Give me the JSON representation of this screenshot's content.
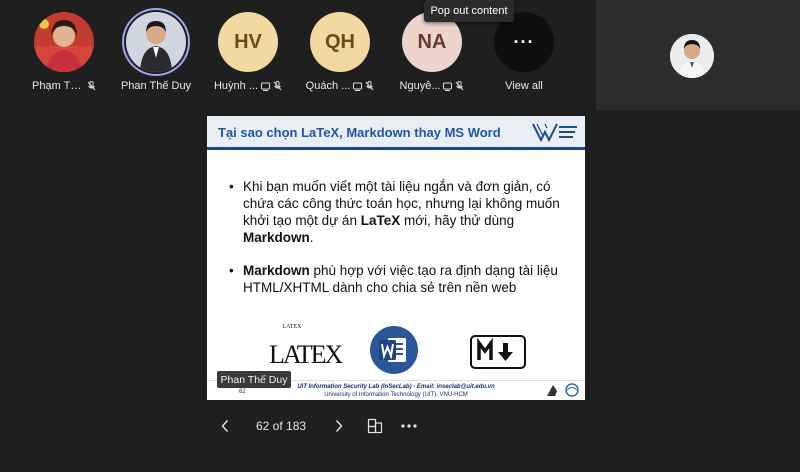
{
  "participants": [
    {
      "name": "Phạm Thị ...",
      "type": "photo",
      "muted": true
    },
    {
      "name": "Phan Thế Duy",
      "type": "photo",
      "muted": false,
      "active": true
    },
    {
      "name": "Huỳnh ...",
      "initials": "HV",
      "type": "initials"
    },
    {
      "name": "Quách ...",
      "initials": "QH",
      "type": "initials"
    },
    {
      "name": "Nguyễ...",
      "initials": "NA",
      "type": "initials"
    }
  ],
  "view_all": {
    "label": "View all",
    "glyph": "···"
  },
  "tooltip": "Pop out content",
  "slide": {
    "title": "Tại sao chọn LaTeX, Markdown thay MS Word",
    "bullet1_pre": "Khi bạn muốn viết một tài liệu ngắn và đơn giản, có chứa các công thức toán học, nhưng lại không muốn khởi tạo một dự án ",
    "bullet1_bold1": "LaTeX",
    "bullet1_mid": " mới, hãy thử dùng ",
    "bullet1_bold2": "Markdown",
    "bullet1_end": ".",
    "bullet2_bold": "Markdown",
    "bullet2_rest": " phù hợp với việc tạo ra định dạng tài liệu HTML/XHTML dành cho chia sẻ trên nền web",
    "latex_small": "LATEX",
    "latex_big": "LATEX",
    "footer_line1": "UIT Information Security Lab (InSecLab) - Email: inseclab@uit.edu.vn",
    "footer_line2": "University of Information Technology (UIT), VNU-HCM",
    "footer_page": "62"
  },
  "presenter_tag": "Phan Thế Duy",
  "navigation": {
    "counter": "62 of 183"
  },
  "colors": {
    "background": "#1f1f1f",
    "slide_title": "#1f56a8",
    "word_blue": "#2b579a",
    "initials_bg": "#f2d9a2"
  }
}
